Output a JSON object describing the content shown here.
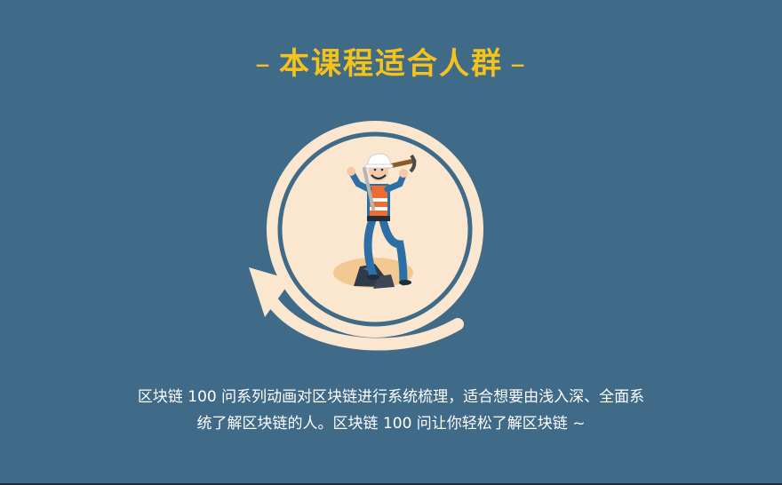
{
  "header": {
    "title": "本课程适合人群",
    "dash_left": "–",
    "dash_right": "–"
  },
  "colors": {
    "background": "#3f6a88",
    "title": "#f5c21b",
    "circle_fill": "#fbe7cf",
    "ring": "#3f6a88",
    "arrow": "#fbe7cf"
  },
  "illustration": {
    "icon": "worker-with-pickaxe-icon"
  },
  "description": {
    "line1": "区块链 100 问系列动画对区块链进行系统梳理，适合想要由浅入深、全面系",
    "line2": "统了解区块链的人。区块链 100 问让你轻松了解区块链 ~"
  }
}
